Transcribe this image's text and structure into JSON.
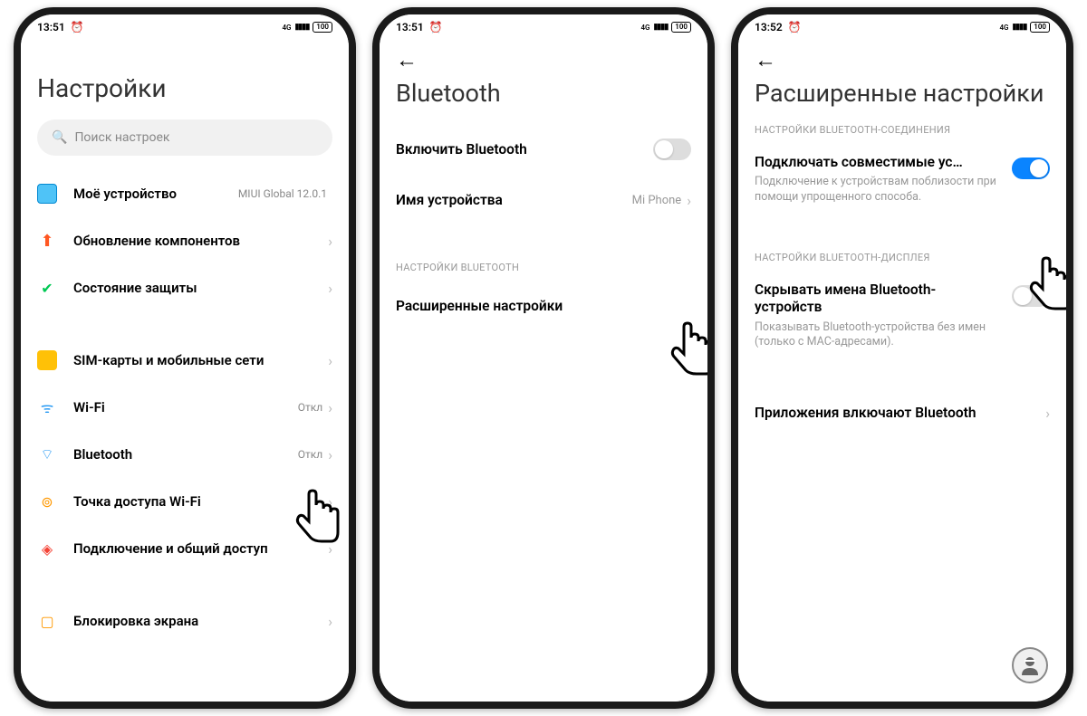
{
  "status": {
    "time_ab": "13:51",
    "time_c": "13:52",
    "battery": "100",
    "alarm_glyph": "⏰",
    "signal_glyph": "▮▮▮▮",
    "fourg": "4G"
  },
  "screenA": {
    "title": "Настройки",
    "search_placeholder": "Поиск настроек",
    "items": {
      "device": {
        "label": "Моё устройство",
        "value": "MIUI Global 12.0.1"
      },
      "update": {
        "label": "Обновление компонентов"
      },
      "security": {
        "label": "Состояние защиты"
      },
      "sim": {
        "label": "SIM-карты и мобильные сети"
      },
      "wifi": {
        "label": "Wi-Fi",
        "value": "Откл"
      },
      "bt": {
        "label": "Bluetooth",
        "value": "Откл"
      },
      "hotspot": {
        "label": "Точка доступа Wi-Fi"
      },
      "share": {
        "label": "Подключение и общий доступ"
      },
      "lockscreen": {
        "label": "Блокировка экрана"
      }
    }
  },
  "screenB": {
    "title": "Bluetooth",
    "enable": "Включить Bluetooth",
    "devname_label": "Имя устройства",
    "devname_value": "Mi Phone",
    "section": "НАСТРОЙКИ BLUETOOTH",
    "advanced": "Расширенные настройки"
  },
  "screenC": {
    "title": "Расширенные настройки",
    "section1": "НАСТРОЙКИ BLUETOOTH-СОЕДИНЕНИЯ",
    "compat_label": "Подключать совместимые ус…",
    "compat_desc": "Подключение к устройствам поблизости при помощи упрощенного способа.",
    "section2": "НАСТРОЙКИ BLUETOOTH-ДИСПЛЕЯ",
    "hide_label": "Скрывать имена Bluetooth-устройств",
    "hide_desc": "Показывать Bluetooth-устройства без имен (только с MAC-адресами).",
    "apps": "Приложения влкючают Bluetooth"
  }
}
